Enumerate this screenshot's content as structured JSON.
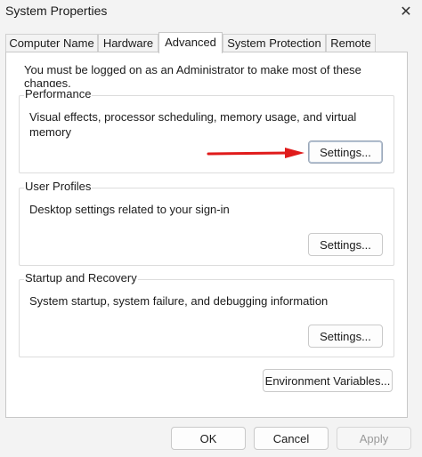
{
  "window": {
    "title": "System Properties",
    "close_glyph": "✕"
  },
  "tabs": [
    {
      "label": "Computer Name",
      "active": false
    },
    {
      "label": "Hardware",
      "active": false
    },
    {
      "label": "Advanced",
      "active": true
    },
    {
      "label": "System Protection",
      "active": false
    },
    {
      "label": "Remote",
      "active": false
    }
  ],
  "admin_note": "You must be logged on as an Administrator to make most of these changes.",
  "performance": {
    "label": "Performance",
    "description": "Visual effects, processor scheduling, memory usage, and virtual memory",
    "button": "Settings..."
  },
  "user_profiles": {
    "label": "User Profiles",
    "description": "Desktop settings related to your sign-in",
    "button": "Settings..."
  },
  "startup_recovery": {
    "label": "Startup and Recovery",
    "description": "System startup, system failure, and debugging information",
    "button": "Settings..."
  },
  "environment_button": "Environment Variables...",
  "footer": {
    "ok": "OK",
    "cancel": "Cancel",
    "apply": "Apply"
  },
  "annotation": {
    "arrow_color": "#e01b1b",
    "icon": "red-arrow-pointing-right"
  }
}
